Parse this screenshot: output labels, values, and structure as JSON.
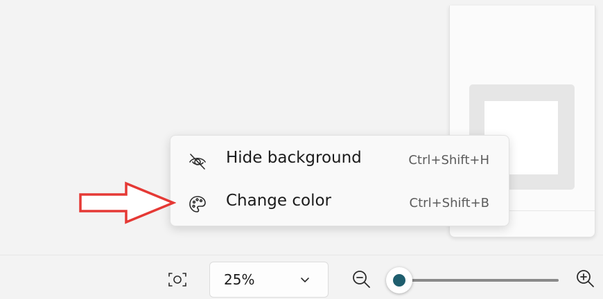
{
  "context_menu": {
    "items": [
      {
        "label": "Hide background",
        "shortcut": "Ctrl+Shift+H",
        "icon": "eye-off-icon"
      },
      {
        "label": "Change color",
        "shortcut": "Ctrl+Shift+B",
        "icon": "palette-icon"
      }
    ]
  },
  "zoom": {
    "value": "25%",
    "slider_fraction": 0.05
  },
  "colors": {
    "accent": "#1f5e6e",
    "annotation_arrow": "#e53935"
  },
  "icons": {
    "fit": "fit-to-window-icon",
    "dropdown": "chevron-down-icon",
    "zoom_out": "zoom-out-icon",
    "zoom_in": "zoom-in-icon"
  }
}
